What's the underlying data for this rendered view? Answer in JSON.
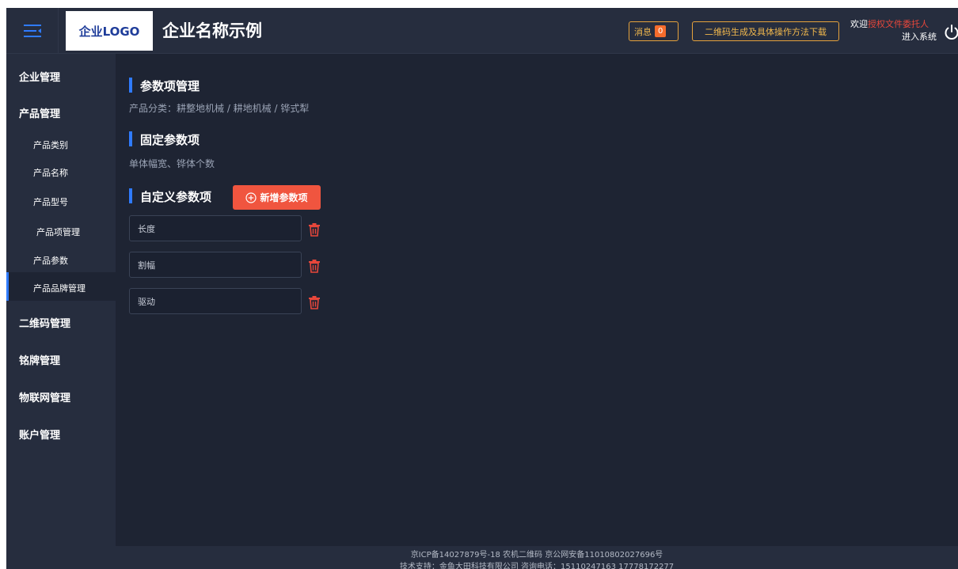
{
  "header": {
    "logo_text": "企业LOGO",
    "company_name": "企业名称示例",
    "messages_label": "消息",
    "messages_count": "0",
    "qr_download_label": "二维码生成及具体操作方法下载",
    "welcome_prefix": "欢迎",
    "welcome_user": "授权文件委托人",
    "enter_system_label": "进入系统"
  },
  "sidebar": {
    "items": [
      {
        "label": "企业管理",
        "level": "top"
      },
      {
        "label": "产品管理",
        "level": "top"
      },
      {
        "label": "产品类别",
        "level": "sub"
      },
      {
        "label": "产品名称",
        "level": "sub"
      },
      {
        "label": "产品型号",
        "level": "sub"
      },
      {
        "label": "产品项管理",
        "level": "sub",
        "active": true
      },
      {
        "label": "产品参数",
        "level": "sub"
      },
      {
        "label": "产品品牌管理",
        "level": "sub"
      },
      {
        "label": "二维码管理",
        "level": "top"
      },
      {
        "label": "铭牌管理",
        "level": "top"
      },
      {
        "label": "物联网管理",
        "level": "top"
      },
      {
        "label": "账户管理",
        "level": "top"
      }
    ]
  },
  "main": {
    "section1": {
      "title": "参数项管理",
      "breadcrumb": "产品分类：耕整地机械 / 耕地机械 / 铧式犁"
    },
    "section2": {
      "title": "固定参数项",
      "description": "单体幅宽、铧体个数"
    },
    "section3": {
      "title": "自定义参数项",
      "add_button_label": "新增参数项",
      "params": [
        {
          "value": "长度"
        },
        {
          "value": "割幅"
        },
        {
          "value": "驱动"
        }
      ]
    }
  },
  "footer": {
    "line1": "京ICP备14027879号-18 农机二维码 京公网安备11010802027696号",
    "line2": "技术支持：金鱼大田科技有限公司    咨询电话：15110247163  17778172277"
  },
  "colors": {
    "background": "#1e2433",
    "panel": "#262d3e",
    "accent_blue": "#2f7bff",
    "accent_red": "#f0553f",
    "warning_gold": "#e6a23c"
  },
  "icons": {
    "menu": "menu-collapse-icon",
    "power": "power-icon",
    "add": "plus-circle-icon",
    "delete": "trash-icon"
  }
}
